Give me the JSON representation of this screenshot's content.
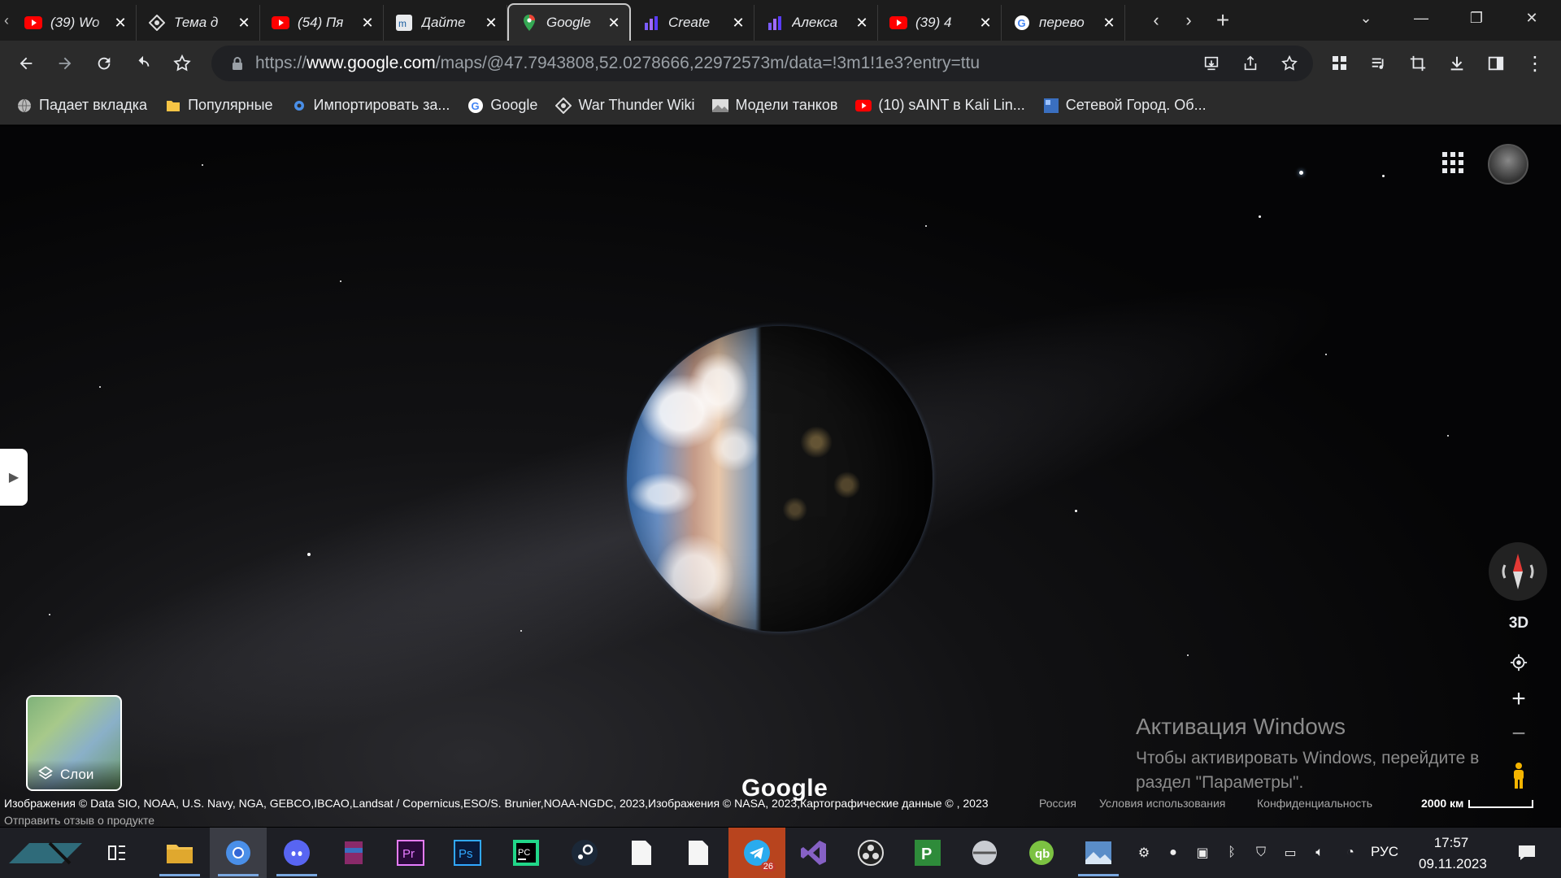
{
  "browser": {
    "tabs": [
      {
        "title": "(39) Wo",
        "icon": "youtube-icon"
      },
      {
        "title": "Тема д",
        "icon": "diamond-icon"
      },
      {
        "title": "(54) Пя",
        "icon": "youtube-icon"
      },
      {
        "title": "Дайте",
        "icon": "m-icon"
      },
      {
        "title": "Google",
        "icon": "maps-pin-icon",
        "active": true
      },
      {
        "title": "Create",
        "icon": "chart-icon"
      },
      {
        "title": "Алекса",
        "icon": "chart-icon"
      },
      {
        "title": "(39) 4",
        "icon": "youtube-icon"
      },
      {
        "title": "перево",
        "icon": "google-icon"
      }
    ],
    "tab_close_glyph": "✕",
    "new_tab_glyph": "+",
    "url_prefix": "https://",
    "url_host": "www.google.com",
    "url_path": "/maps/@47.7943808,52.0278666,22972573m/data=!3m1!1e3?entry=ttu"
  },
  "bookmarks": [
    {
      "label": "Падает вкладка",
      "icon": "globe-icon"
    },
    {
      "label": "Популярные",
      "icon": "folder-icon"
    },
    {
      "label": "Импортировать за...",
      "icon": "gear-icon"
    },
    {
      "label": "Google",
      "icon": "google-icon"
    },
    {
      "label": "War Thunder Wiki",
      "icon": "diamond-icon"
    },
    {
      "label": "Модели танков",
      "icon": "image-icon"
    },
    {
      "label": "(10) sAINT в Kali Lin...",
      "icon": "youtube-icon"
    },
    {
      "label": "Сетевой Город. Об...",
      "icon": "app-icon"
    }
  ],
  "map": {
    "layers_label": "Слои",
    "btn_3d": "3D",
    "zoom_in": "+",
    "zoom_out": "−",
    "google_logo": "Google",
    "attribution": "Изображения © Data SIO, NOAA, U.S. Navy, NGA, GEBCO,IBCAO,Landsat / Copernicus,ESO/S. Brunier,NOAA-NGDC, 2023,Изображения © NASA, 2023,Картографические данные © , 2023",
    "country": "Россия",
    "terms": "Условия использования",
    "privacy": "Конфиденциальность",
    "scale": "2000 км",
    "feedback": "Отправить отзыв о продукте"
  },
  "watermark": {
    "title": "Активация Windows",
    "line1": "Чтобы активировать Windows, перейдите в",
    "line2": "раздел \"Параметры\"."
  },
  "taskbar": {
    "lang": "РУС",
    "time": "17:57",
    "date": "09.11.2023",
    "telegram_badge": "26"
  }
}
